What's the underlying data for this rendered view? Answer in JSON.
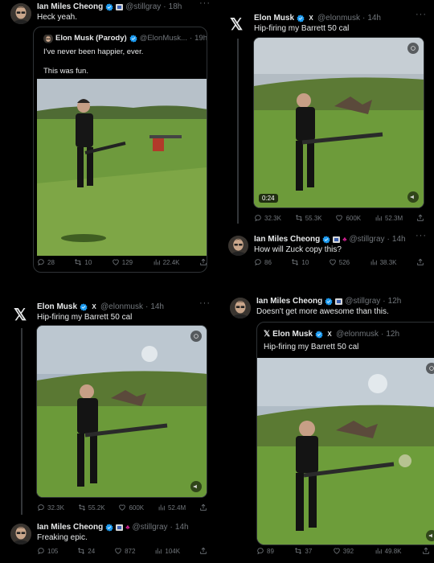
{
  "p1": {
    "author": "Ian Miles Cheong",
    "handle": "@stillgray",
    "time": "18h",
    "text": "Heck yeah.",
    "quote": {
      "author": "Elon Musk (Parody)",
      "handle": "@ElonMusk...",
      "time": "19h",
      "line1": "I've never been happier, ever.",
      "line2": "This was fun."
    },
    "stats": {
      "replies": "28",
      "reposts": "10",
      "likes": "129",
      "views": "22.4K"
    }
  },
  "p2": {
    "author": "Elon Musk",
    "handle": "@elonmusk",
    "time": "14h",
    "text": "Hip-firing my Barrett 50 cal",
    "duration": "0:24",
    "stats": {
      "replies": "32.3K",
      "reposts": "55.3K",
      "likes": "600K",
      "views": "52.3M"
    },
    "reply": {
      "author": "Ian Miles Cheong",
      "handle": "@stillgray",
      "time": "14h",
      "text": "How will Zuck copy this?",
      "stats": {
        "replies": "86",
        "reposts": "10",
        "likes": "526",
        "views": "38.3K"
      }
    }
  },
  "p3": {
    "author": "Elon Musk",
    "handle": "@elonmusk",
    "time": "14h",
    "text": "Hip-firing my Barrett 50 cal",
    "stats": {
      "replies": "32.3K",
      "reposts": "55.2K",
      "likes": "600K",
      "views": "52.4M"
    },
    "reply": {
      "author": "Ian Miles Cheong",
      "handle": "@stillgray",
      "time": "14h",
      "text": "Freaking epic.",
      "stats": {
        "replies": "105",
        "reposts": "24",
        "likes": "872",
        "views": "104K"
      }
    }
  },
  "p4": {
    "author": "Ian Miles Cheong",
    "handle": "@stillgray",
    "time": "12h",
    "text": "Doesn't get more awesome than this.",
    "quote": {
      "author": "Elon Musk",
      "handle": "@elonmusk",
      "time": "12h",
      "text": "Hip-firing my Barrett 50 cal"
    },
    "stats": {
      "replies": "89",
      "reposts": "37",
      "likes": "392",
      "views": "49.8K"
    }
  },
  "colors": {
    "bg": "#000000",
    "text": "#e7e9ea",
    "muted": "#71767b",
    "verified": "#1d9bf0"
  }
}
